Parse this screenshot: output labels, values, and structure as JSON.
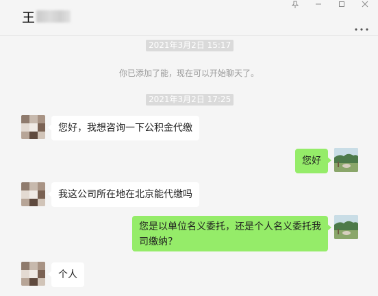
{
  "header": {
    "title": "王",
    "menu_icon": "more-dots-icon",
    "window_controls": [
      "pin-icon",
      "minimize-icon",
      "maximize-icon",
      "close-icon"
    ]
  },
  "messages": {
    "time1": "2021年3月2日 15:17",
    "system_notice": "你已添加了能，现在可以开始聊天了。",
    "time2": "2021年3月2日 17:25",
    "msg1": "您好，我想咨询一下公积金代缴",
    "msg2": "您好",
    "msg3": "我这公司所在地在北京能代缴吗",
    "msg4_line1": "您是以单位名义委托，还是个人名义委托我",
    "msg4_line2": "司缴纳？",
    "msg5": "个人"
  },
  "colors": {
    "sent_bubble": "#95ec69",
    "received_bubble": "#ffffff",
    "background": "#f5f5f5"
  }
}
